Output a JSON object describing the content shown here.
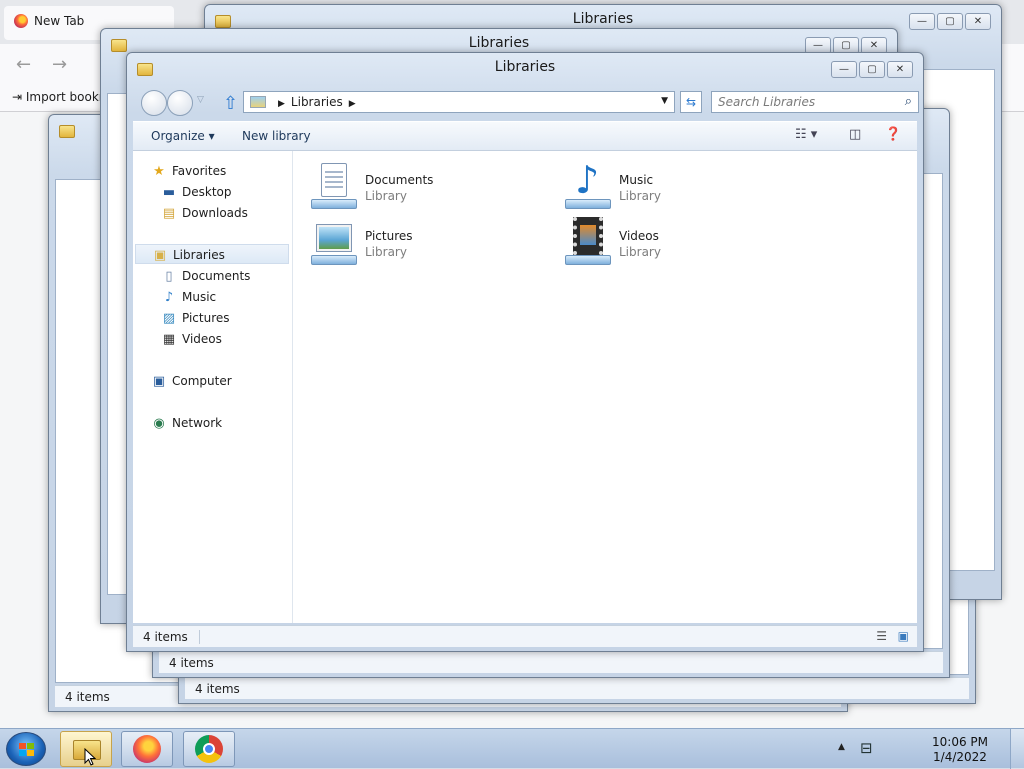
{
  "browser": {
    "tab_title": "New Tab",
    "bookmark_label": "Import bookmarks..."
  },
  "windows": {
    "title": "Libraries",
    "status_count": "4 items"
  },
  "main": {
    "title": "Libraries",
    "address": {
      "crumb": "Libraries"
    },
    "search": {
      "placeholder": "Search Libraries"
    },
    "commands": {
      "organize": "Organize",
      "new_library": "New library"
    },
    "nav": {
      "favorites": "Favorites",
      "desktop": "Desktop",
      "downloads": "Downloads",
      "libraries": "Libraries",
      "documents": "Documents",
      "music": "Music",
      "pictures": "Pictures",
      "videos": "Videos",
      "computer": "Computer",
      "network": "Network"
    },
    "items": [
      {
        "name": "Documents",
        "type": "Library"
      },
      {
        "name": "Music",
        "type": "Library"
      },
      {
        "name": "Pictures",
        "type": "Library"
      },
      {
        "name": "Videos",
        "type": "Library"
      }
    ],
    "status": "4 items"
  },
  "taskbar": {
    "time": "10:06 PM",
    "date": "1/4/2022",
    "apps": [
      "windows-explorer-icon",
      "firefox-icon",
      "chrome-icon"
    ]
  },
  "colors": {
    "accent": "#2e7bd0",
    "window_frame": "#c6d4e6",
    "taskbar": "#a9bfdc"
  }
}
